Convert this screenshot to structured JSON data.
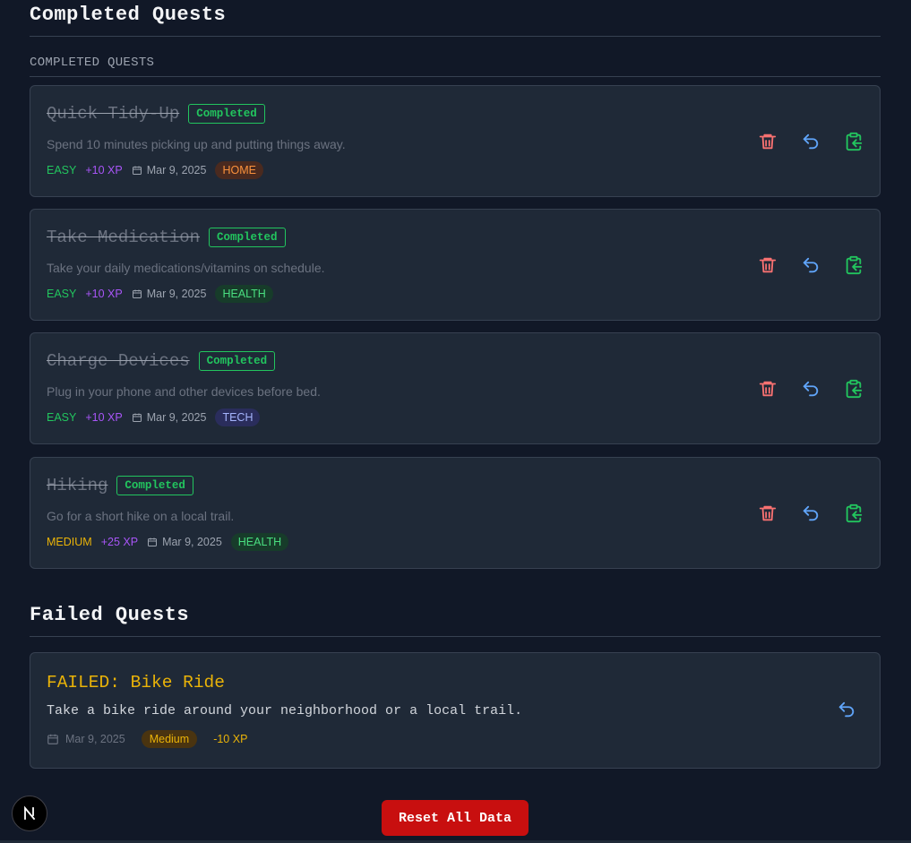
{
  "completed": {
    "title": "Completed Quests",
    "subheading": "COMPLETED QUESTS",
    "quests": [
      {
        "title": "Quick Tidy-Up",
        "status": "Completed",
        "description": "Spend 10 minutes picking up and putting things away.",
        "difficulty": "EASY",
        "xp": "+10 XP",
        "date": "Mar 9, 2025",
        "tag": "HOME"
      },
      {
        "title": "Take Medication",
        "status": "Completed",
        "description": "Take your daily medications/vitamins on schedule.",
        "difficulty": "EASY",
        "xp": "+10 XP",
        "date": "Mar 9, 2025",
        "tag": "HEALTH"
      },
      {
        "title": "Charge Devices",
        "status": "Completed",
        "description": "Plug in your phone and other devices before bed.",
        "difficulty": "EASY",
        "xp": "+10 XP",
        "date": "Mar 9, 2025",
        "tag": "TECH"
      },
      {
        "title": "Hiking",
        "status": "Completed",
        "description": "Go for a short hike on a local trail.",
        "difficulty": "MEDIUM",
        "xp": "+25 XP",
        "date": "Mar 9, 2025",
        "tag": "HEALTH"
      }
    ]
  },
  "failed": {
    "title": "Failed Quests",
    "quests": [
      {
        "title": "FAILED: Bike Ride",
        "description": "Take a bike ride around your neighborhood or a local trail.",
        "date": "Mar 9, 2025",
        "difficulty": "Medium",
        "xp": "-10 XP"
      }
    ]
  },
  "reset_label": "Reset All Data",
  "nextjs_badge": "N",
  "icons": {
    "delete": "trash-icon",
    "undo": "undo-icon",
    "copy": "clipboard-copy-icon",
    "calendar": "calendar-icon"
  },
  "colors": {
    "background": "#111827",
    "card": "#1f2937",
    "completed": "#22c55e",
    "delete": "#f87171",
    "undo": "#60a5fa",
    "xp": "#a855f7",
    "medium": "#eab308",
    "reset": "#c80f0f"
  }
}
